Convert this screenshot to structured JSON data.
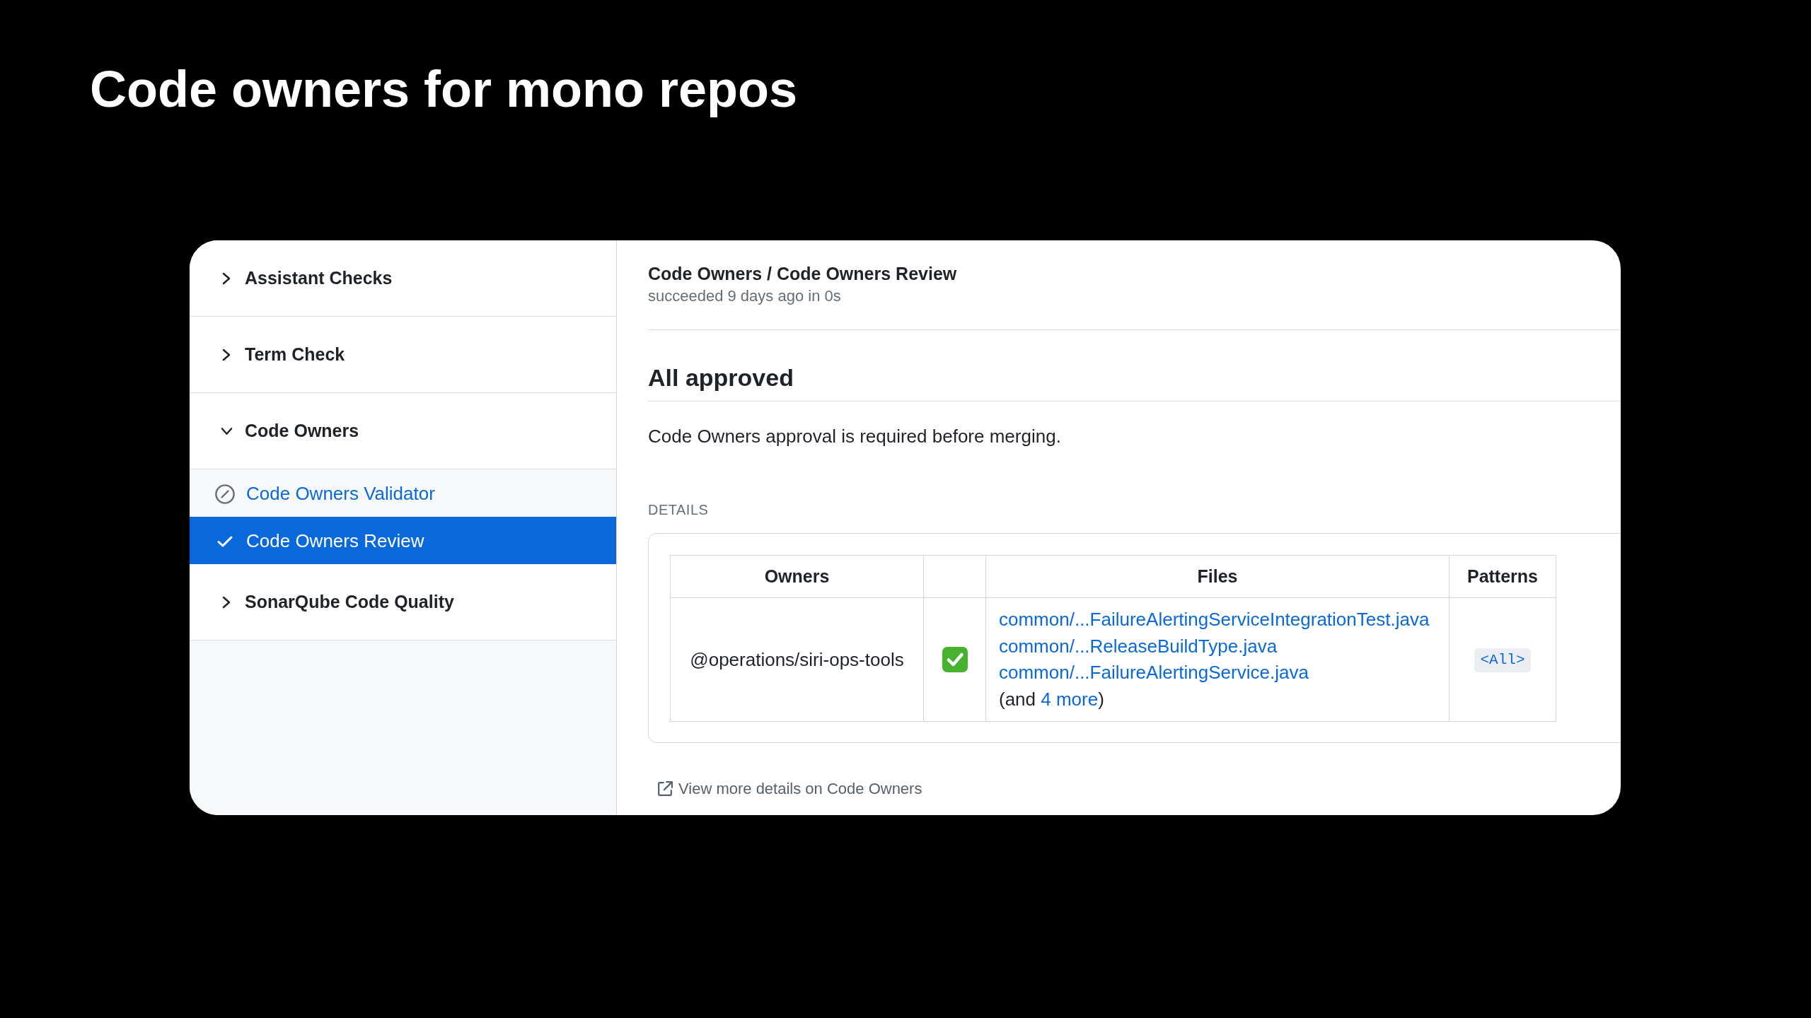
{
  "slide_title": "Code owners for mono repos",
  "sidebar": {
    "groups": [
      {
        "label": "Assistant Checks",
        "expanded": false
      },
      {
        "label": "Term Check",
        "expanded": false
      },
      {
        "label": "Code Owners",
        "expanded": true,
        "children": [
          {
            "kind": "skipped",
            "label": "Code Owners Validator",
            "selected": false
          },
          {
            "kind": "success",
            "label": "Code Owners Review",
            "selected": true
          }
        ]
      },
      {
        "label": "SonarQube Code Quality",
        "expanded": false
      }
    ]
  },
  "detail": {
    "title": "Code Owners / Code Owners Review",
    "subtitle": "succeeded 9 days ago in 0s",
    "heading": "All approved",
    "description": "Code Owners approval is required before merging.",
    "section_label": "DETAILS",
    "table": {
      "columns": [
        {
          "kind": "owner",
          "label": "Owners"
        },
        {
          "kind": "status"
        },
        {
          "kind": "files",
          "label": "Files"
        },
        {
          "kind": "pattern",
          "label": "Patterns"
        }
      ],
      "rows": [
        {
          "owner": "@operations/siri-ops-tools",
          "approved": true,
          "files": [
            "common/...FailureAlertingServiceIntegrationTest.java",
            "common/...ReleaseBuildType.java",
            "common/...FailureAlertingService.java"
          ],
          "more_prefix": "(and",
          "more_link": "4 more",
          "more_suffix": ")",
          "pattern": "<All>"
        }
      ]
    },
    "footer_link": "View more details on Code Owners"
  }
}
